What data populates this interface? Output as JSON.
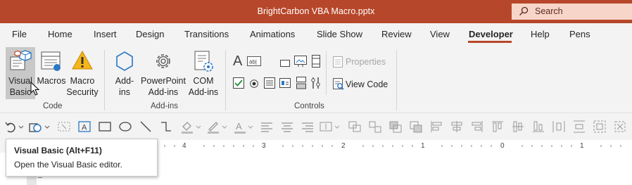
{
  "window": {
    "title": "BrightCarbon VBA Macro.pptx"
  },
  "search": {
    "label": "Search"
  },
  "tabs": [
    "File",
    "Home",
    "Insert",
    "Design",
    "Transitions",
    "Animations",
    "Slide Show",
    "Review",
    "View",
    "Developer",
    "Help",
    "Pens"
  ],
  "active_tab": "Developer",
  "ribbon": {
    "code": {
      "label": "Code",
      "visual_basic": [
        "Visual",
        "Basic"
      ],
      "macros": "Macros",
      "macro_security": [
        "Macro",
        "Security"
      ]
    },
    "addins": {
      "label": "Add-ins",
      "addins": [
        "Add-",
        "ins"
      ],
      "powerpoint_addins": [
        "PowerPoint",
        "Add-ins"
      ],
      "com_addins": [
        "COM",
        "Add-ins"
      ]
    },
    "controls": {
      "label": "Controls",
      "properties": "Properties",
      "view_code": "View Code"
    }
  },
  "ruler": {
    "numbers": [
      "4",
      "3",
      "2",
      "1",
      "0",
      "1"
    ]
  },
  "tooltip": {
    "title": "Visual Basic (Alt+F11)",
    "description": "Open the Visual Basic editor."
  },
  "colors": {
    "accent": "#b7472a",
    "search_bg": "#f7d5c8",
    "icon_blue": "#2b78c5"
  }
}
